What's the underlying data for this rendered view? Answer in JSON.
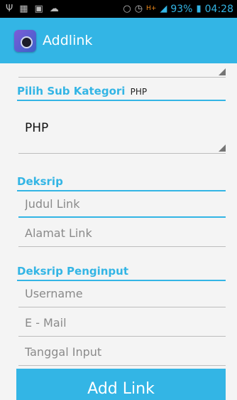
{
  "status": {
    "icons": [
      "usb-icon",
      "image-icon",
      "gallery-icon",
      "cloud-icon",
      "vibrate-icon",
      "alarm-icon",
      "network-hplus-icon",
      "signal-icon",
      "battery-icon"
    ],
    "network_label": "H+",
    "battery": "93%",
    "time": "04:28"
  },
  "app": {
    "title": "Addlink",
    "accent": "#33b5e5"
  },
  "form": {
    "sub_category_label": "Pilih Sub Kategori",
    "sub_category_selected_caption": "PHP",
    "sub_category_value": "PHP",
    "description_header": "Deksrip",
    "link_title_placeholder": "Judul Link",
    "link_address_placeholder": "Alamat Link",
    "inputter_header": "Deksrip Penginput",
    "username_placeholder": "Username",
    "email_placeholder": "E - Mail",
    "input_date_placeholder": "Tanggal Input",
    "submit_label": "Add Link"
  }
}
